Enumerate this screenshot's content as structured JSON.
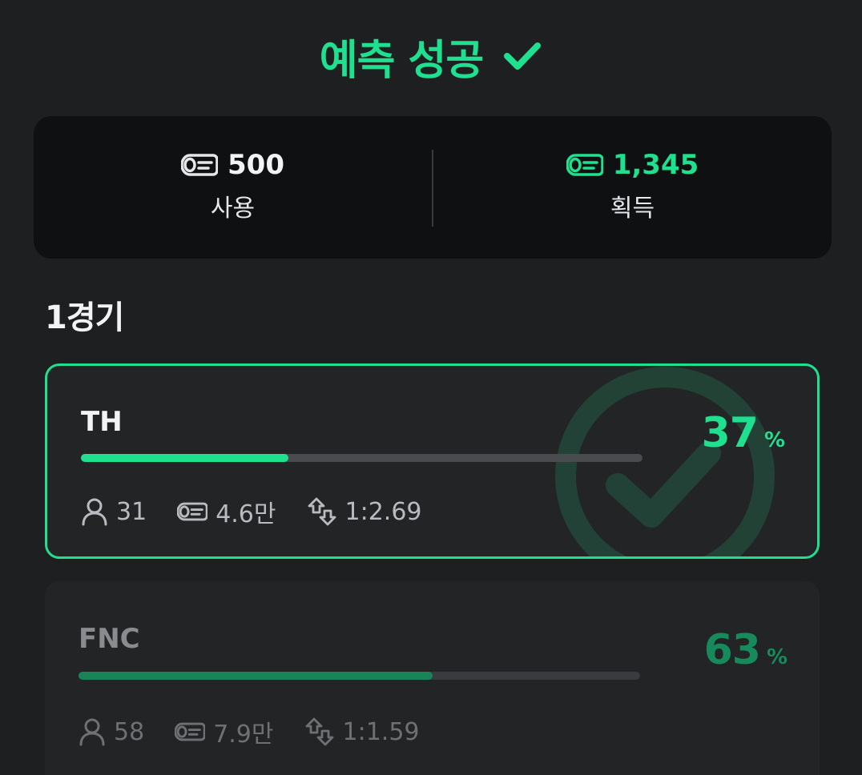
{
  "header": {
    "title": "예측 성공"
  },
  "summary": {
    "used": {
      "value": "500",
      "label": "사용"
    },
    "earned": {
      "value": "1,345",
      "label": "획득"
    }
  },
  "match": {
    "title": "1경기"
  },
  "teams": [
    {
      "name": "TH",
      "percent": "37",
      "percent_sign": "%",
      "bar_fraction": 0.37,
      "participants": "31",
      "pool": "4.6만",
      "odds": "1:2.69",
      "result": "win"
    },
    {
      "name": "FNC",
      "percent": "63",
      "percent_sign": "%",
      "bar_fraction": 0.63,
      "participants": "58",
      "pool": "7.9만",
      "odds": "1:1.59",
      "result": "lose"
    }
  ],
  "colors": {
    "accent": "#1fe08f",
    "accent_dim": "#178a5c",
    "background": "#1e1f21",
    "summary_bg": "#0f1012"
  },
  "icons": {
    "header": "checkmark-icon",
    "coin": "coin-ticket-icon",
    "user": "user-icon",
    "odds": "swap-arrows-icon",
    "winner_badge": "check-circle-icon"
  }
}
